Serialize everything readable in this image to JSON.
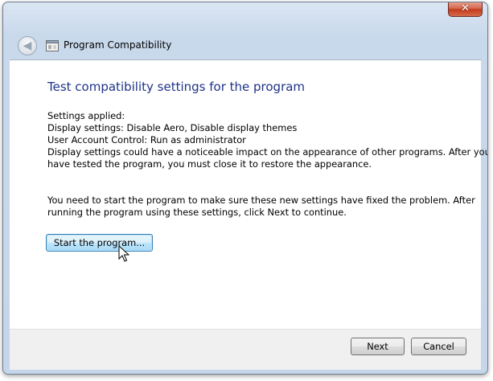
{
  "window": {
    "title": "Program Compatibility",
    "close_label": "✕",
    "back_label": "◀"
  },
  "main": {
    "heading": "Test compatibility settings for the program",
    "settings_lines": [
      "Settings applied:",
      "Display settings:  Disable Aero, Disable display themes",
      "User Account Control:  Run as administrator",
      "Display settings could have a noticeable impact on the appearance of other programs.  After you",
      "have tested the program, you must close it to restore the appearance."
    ],
    "instruction_lines": [
      "You need to start the program to make sure these new settings have fixed the problem. After",
      "running the program using these settings, click Next to continue."
    ],
    "start_button": "Start the program..."
  },
  "footer": {
    "next_button": "Next",
    "cancel_button": "Cancel"
  },
  "icons": {
    "back": "back-arrow-icon",
    "app": "program-compatibility-icon",
    "close": "close-icon",
    "cursor": "mouse-cursor-icon"
  },
  "colors": {
    "heading": "#1e3287",
    "close_button": "#c23c1e",
    "frame": "#c5d6ea"
  }
}
